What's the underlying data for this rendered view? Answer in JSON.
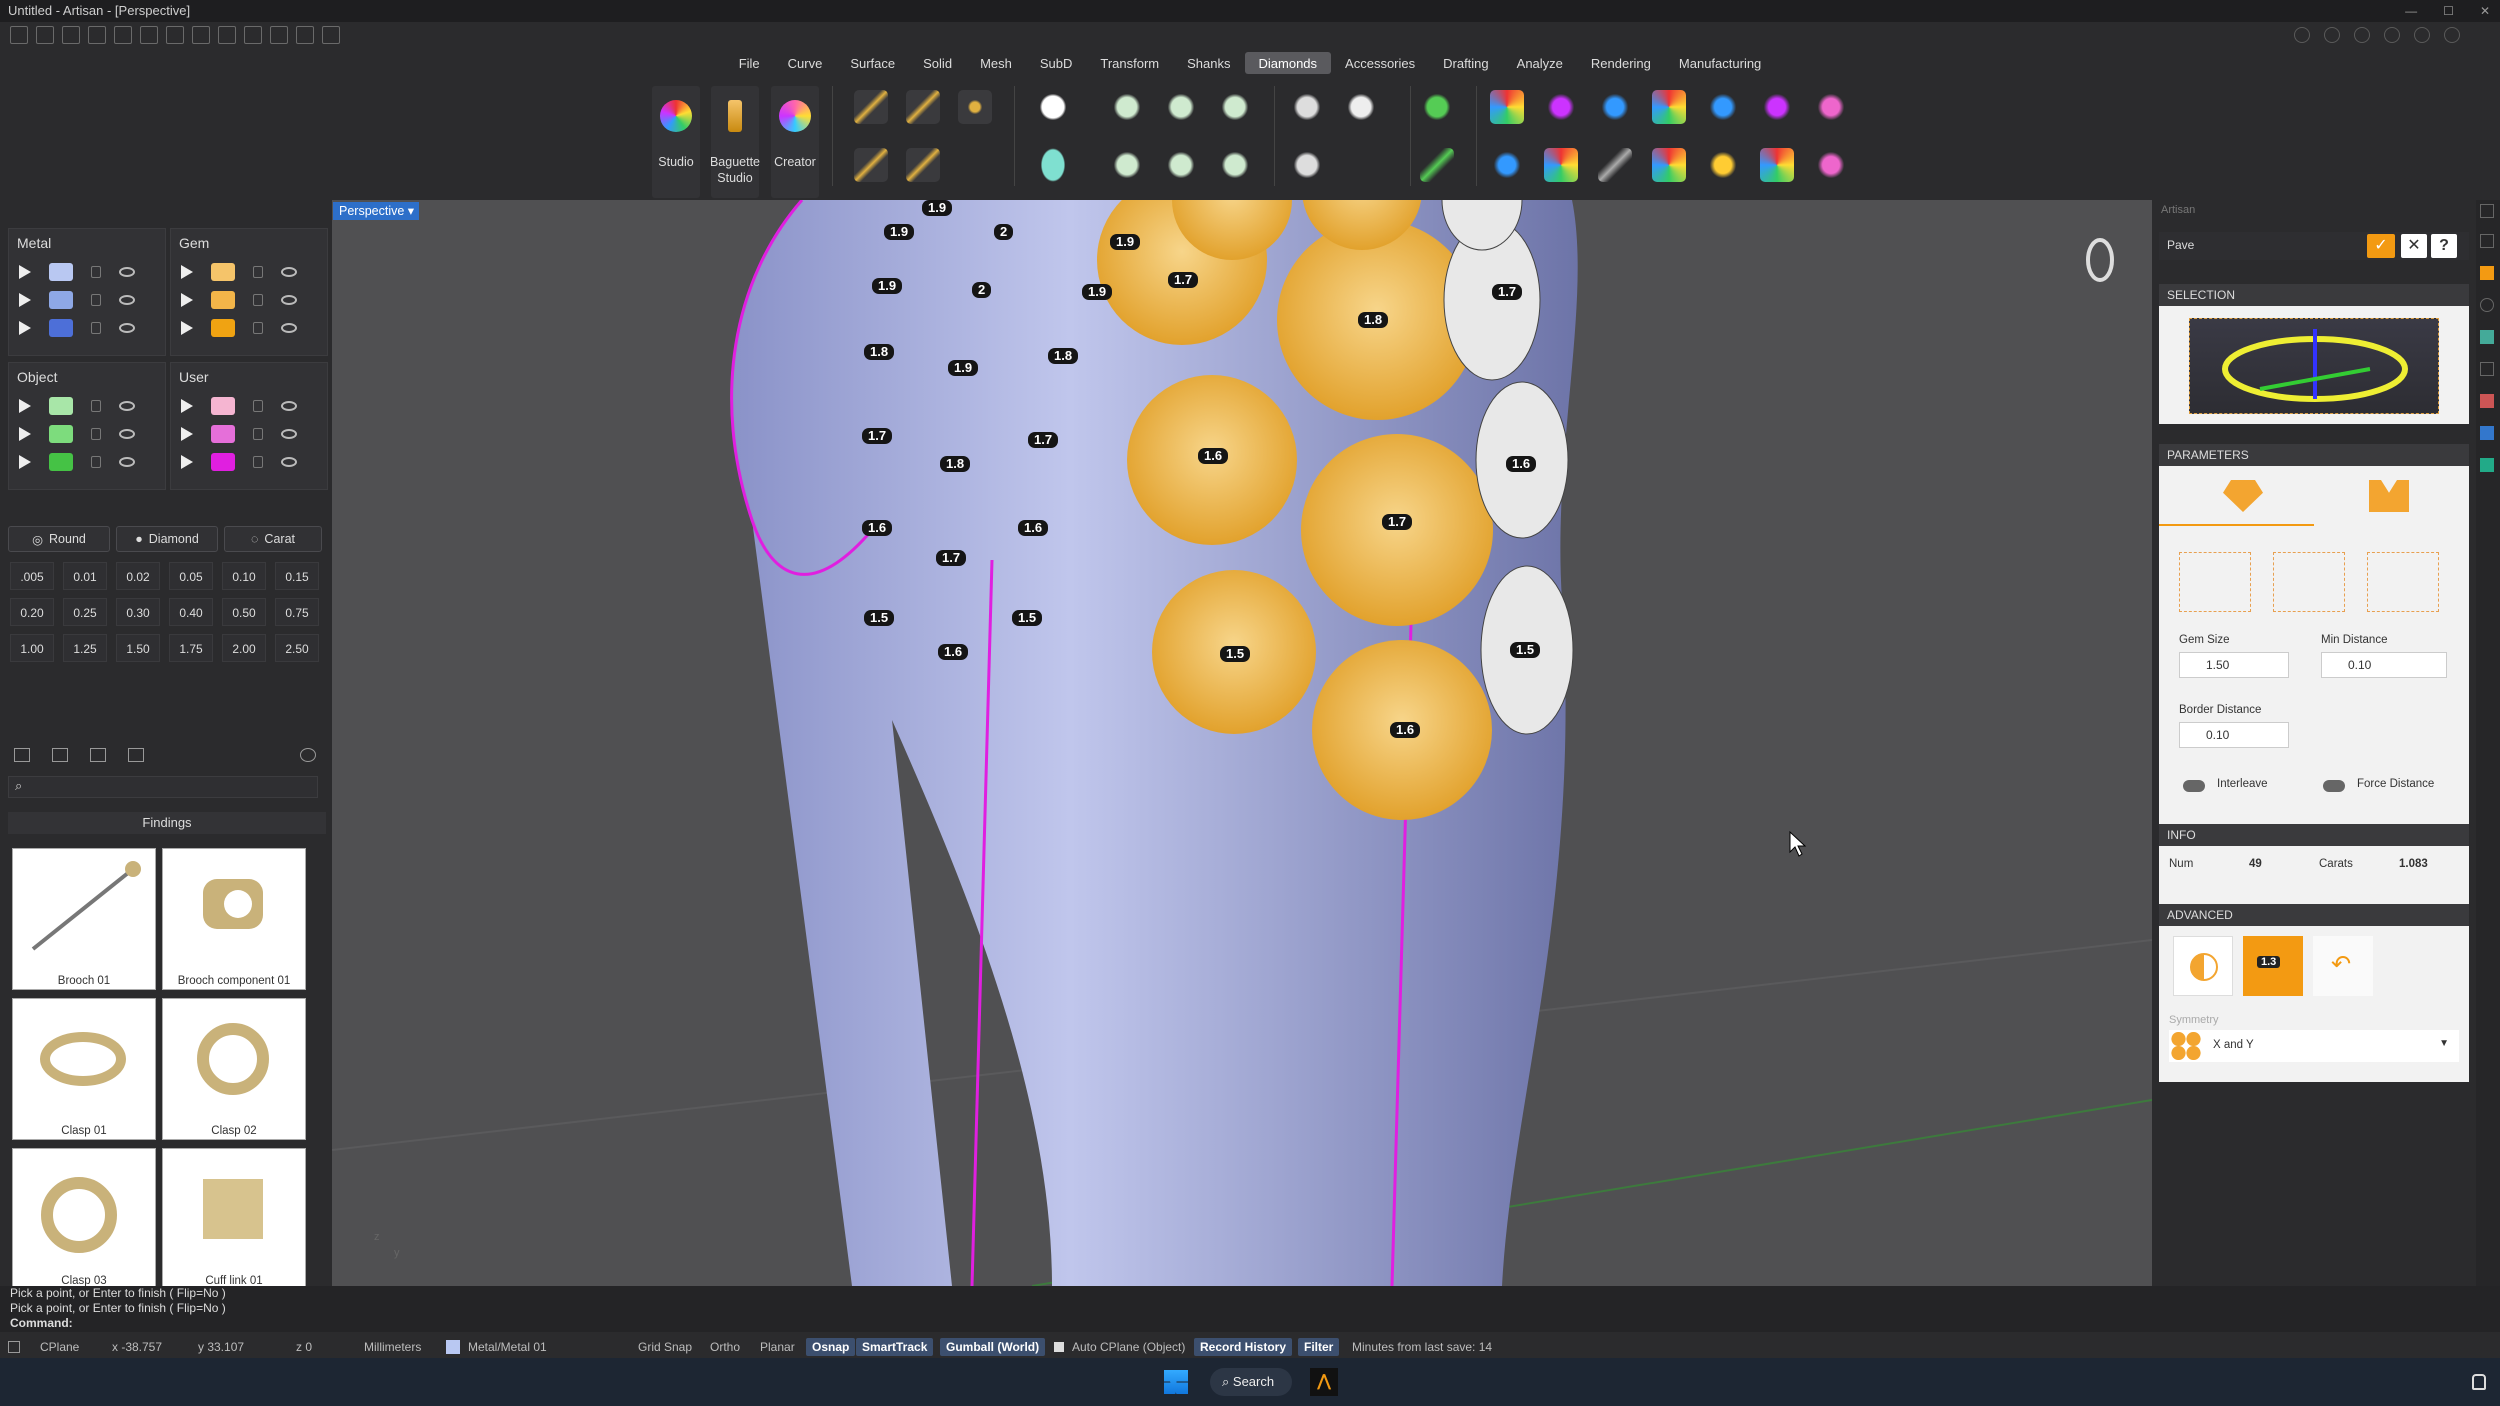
{
  "window": {
    "title": "Untitled - Artisan - [Perspective]"
  },
  "menu": {
    "items": [
      "File",
      "Curve",
      "Surface",
      "Solid",
      "Mesh",
      "SubD",
      "Transform",
      "Shanks",
      "Diamonds",
      "Accessories",
      "Drafting",
      "Analyze",
      "Rendering",
      "Manufacturing"
    ],
    "active": "Diamonds"
  },
  "ribbon": {
    "studio": "Studio",
    "baguette": "Baguette Studio",
    "creator": "Creator"
  },
  "layers": {
    "metal": "Metal",
    "gem": "Gem",
    "object": "Object",
    "user": "User",
    "metal_colors": [
      "#b9c8f2",
      "#8ea8e6",
      "#4d6fd8"
    ],
    "gem_colors": [
      "#f5c46a",
      "#f3b549",
      "#f0a312"
    ],
    "object_colors": [
      "#a8e6a8",
      "#7ddc7d",
      "#45c245"
    ],
    "user_colors": [
      "#f5b5d1",
      "#e56fd9",
      "#e01fe0"
    ]
  },
  "gem_selector": {
    "cut": "Round",
    "material": "Diamond",
    "unit": "Carat"
  },
  "gem_sizes": [
    ".005",
    "0.01",
    "0.02",
    "0.05",
    "0.10",
    "0.15",
    "0.20",
    "0.25",
    "0.30",
    "0.40",
    "0.50",
    "0.75",
    "1.00",
    "1.25",
    "1.50",
    "1.75",
    "2.00",
    "2.50"
  ],
  "library": {
    "section": "Findings",
    "items": [
      "Brooch 01",
      "Brooch component 01",
      "Clasp 01",
      "Clasp 02",
      "Clasp 03",
      "Cuff link 01"
    ]
  },
  "viewport": {
    "label": "Perspective",
    "tags": [
      "1.9",
      "2",
      "1.9",
      "1.9",
      "2",
      "1.9",
      "1.7",
      "1.8",
      "1.8",
      "1.9",
      "1.8",
      "1.7",
      "1.7",
      "1.8",
      "1.7",
      "1.6",
      "1.6",
      "1.7",
      "1.6",
      "1.7",
      "1.6",
      "1.5",
      "1.5",
      "1.6",
      "1.5",
      "1.6",
      "1.5",
      "1.9"
    ]
  },
  "pave_panel": {
    "command": "Pave",
    "selection": "SELECTION",
    "parameters": "PARAMETERS",
    "gem_size_label": "Gem Size",
    "gem_size": "1.50",
    "min_distance_label": "Min Distance",
    "min_distance": "0.10",
    "border_distance_label": "Border Distance",
    "border_distance": "0.10",
    "interleave": "Interleave",
    "force_distance": "Force Distance",
    "info": "INFO",
    "num_label": "Num",
    "num": "49",
    "carats_label": "Carats",
    "carats": "1.083",
    "advanced": "ADVANCED",
    "adv_value": "1.3",
    "symmetry_label": "Symmetry",
    "symmetry": "X and Y",
    "panel_title": "Artisan"
  },
  "command_line": {
    "history": [
      "Pick a point, or Enter to finish ( Flip=No )",
      "Pick a point, or Enter to finish ( Flip=No )"
    ],
    "prompt": "Command:"
  },
  "status": {
    "cplane": "CPlane",
    "x": "x -38.757",
    "y": "y 33.107",
    "z": "z 0",
    "units": "Millimeters",
    "layer": "Metal/Metal 01",
    "grid_snap": "Grid Snap",
    "ortho": "Ortho",
    "planar": "Planar",
    "osnap": "Osnap",
    "smarttrack": "SmartTrack",
    "gumball": "Gumball (World)",
    "auto_cplane": "Auto CPlane (Object)",
    "record_history": "Record History",
    "filter": "Filter",
    "last_save": "Minutes from last save: 14"
  },
  "taskbar": {
    "search": "Search"
  }
}
